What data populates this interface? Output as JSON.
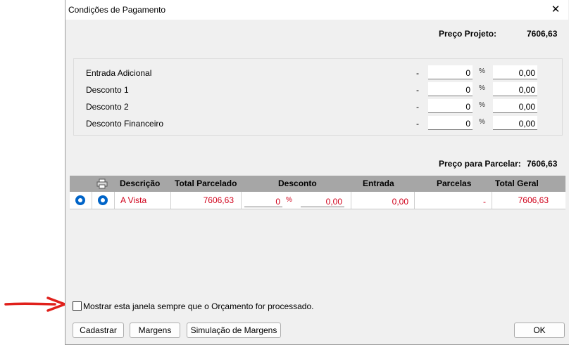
{
  "window": {
    "title": "Condições de Pagamento",
    "close_glyph": "✕"
  },
  "summary": {
    "preco_projeto_label": "Preço Projeto:",
    "preco_projeto_value": "7606,63",
    "preco_parcelar_label": "Preço para Parcelar:",
    "preco_parcelar_value": "7606,63"
  },
  "adjustments": [
    {
      "label": "Entrada Adicional",
      "dash": "-",
      "percent": "0",
      "pct_symbol": "%",
      "value": "0,00"
    },
    {
      "label": "Desconto 1",
      "dash": "-",
      "percent": "0",
      "pct_symbol": "%",
      "value": "0,00"
    },
    {
      "label": "Desconto 2",
      "dash": "-",
      "percent": "0",
      "pct_symbol": "%",
      "value": "0,00"
    },
    {
      "label": "Desconto Financeiro",
      "dash": "-",
      "percent": "0",
      "pct_symbol": "%",
      "value": "0,00"
    }
  ],
  "grid": {
    "columns": {
      "descricao": "Descrição",
      "total_parcelado": "Total Parcelado",
      "desconto": "Desconto",
      "entrada": "Entrada",
      "parcelas": "Parcelas",
      "total_geral": "Total Geral"
    },
    "rows": [
      {
        "descricao": "A Vista",
        "total_parcelado": "7606,63",
        "desconto_percent": "0",
        "pct_symbol": "%",
        "desconto_value": "0,00",
        "entrada": "0,00",
        "parcelas": "-",
        "total_geral": "7606,63"
      }
    ]
  },
  "checkbox": {
    "label": "Mostrar esta janela sempre que o Orçamento for processado.",
    "checked": false
  },
  "buttons": {
    "cadastrar": "Cadastrar",
    "margens": "Margens",
    "simulacao": "Simulação de Margens",
    "ok": "OK"
  },
  "colors": {
    "accent_red": "#d0021b",
    "radio_blue": "#0064c8",
    "arrow_red": "#e0201b",
    "header_gray": "#a6a6a6"
  }
}
